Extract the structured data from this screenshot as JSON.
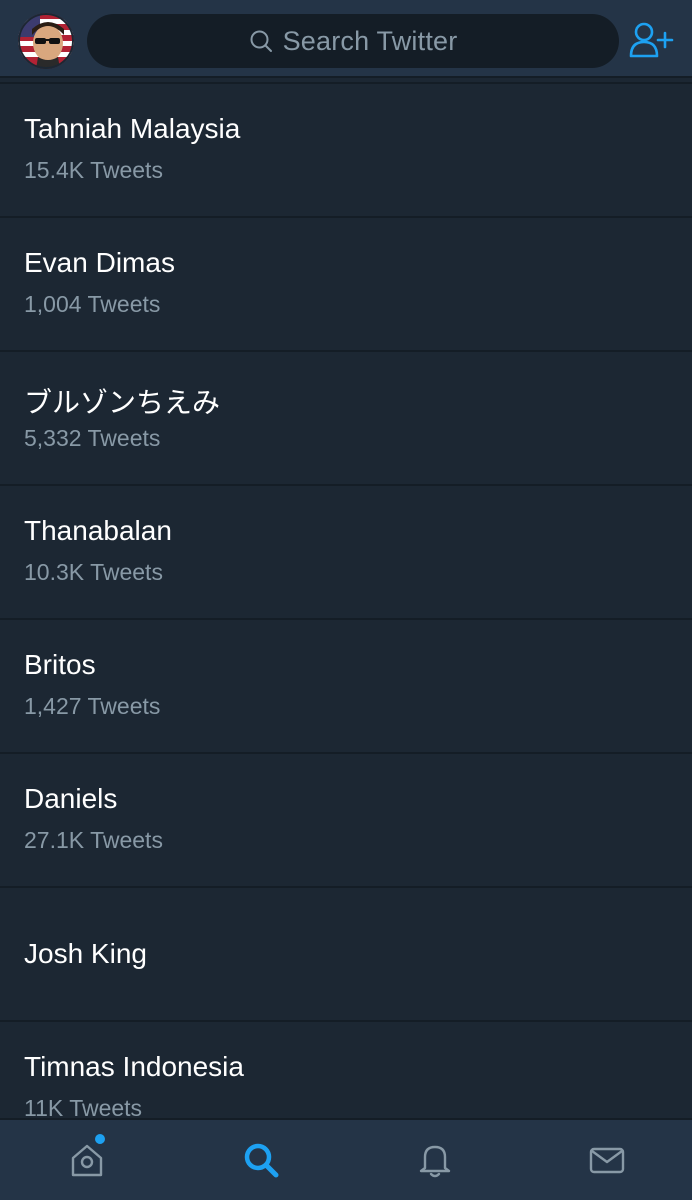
{
  "header": {
    "search_placeholder": "Search Twitter",
    "avatar_icon": "user-avatar",
    "add_user_icon": "add-user-icon",
    "accent_color": "#1da1f2"
  },
  "trends": [
    {
      "name": "Tahniah Malaysia",
      "count": "15.4K Tweets"
    },
    {
      "name": "Evan Dimas",
      "count": "1,004 Tweets"
    },
    {
      "name": "ブルゾンちえみ",
      "count": "5,332 Tweets"
    },
    {
      "name": "Thanabalan",
      "count": "10.3K Tweets"
    },
    {
      "name": "Britos",
      "count": "1,427 Tweets"
    },
    {
      "name": "Daniels",
      "count": "27.1K Tweets"
    },
    {
      "name": "Josh King",
      "count": ""
    },
    {
      "name": "Timnas Indonesia",
      "count": "11K Tweets"
    }
  ],
  "tabbar": {
    "tabs": [
      {
        "name": "home",
        "icon": "home-icon",
        "active": false,
        "has_notification_dot": true
      },
      {
        "name": "search",
        "icon": "search-icon",
        "active": true
      },
      {
        "name": "notifications",
        "icon": "bell-icon",
        "active": false
      },
      {
        "name": "messages",
        "icon": "mail-icon",
        "active": false
      }
    ]
  }
}
